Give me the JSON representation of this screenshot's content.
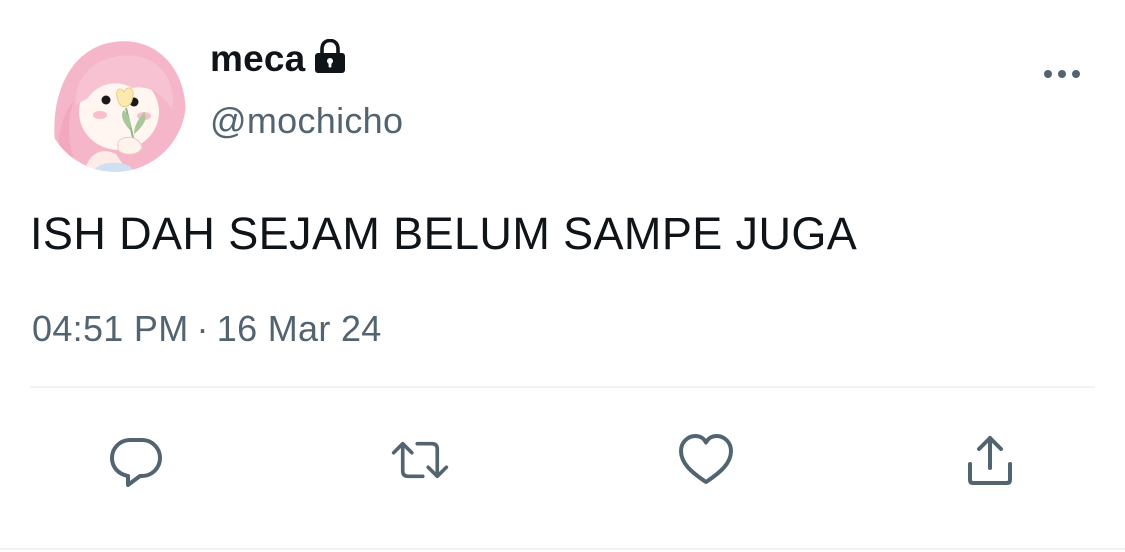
{
  "user": {
    "display_name": "meca",
    "handle": "@mochicho",
    "protected_icon": "lock-icon",
    "avatar": "avatar-illustration"
  },
  "tweet": {
    "text": "ISH DAH SEJAM BELUM SAMPE JUGA",
    "time": "04:51 PM",
    "separator": "·",
    "date": "16 Mar 24"
  },
  "actions": [
    {
      "name": "reply",
      "icon": "reply-icon"
    },
    {
      "name": "retweet",
      "icon": "retweet-icon"
    },
    {
      "name": "like",
      "icon": "heart-icon"
    },
    {
      "name": "share",
      "icon": "share-icon"
    }
  ],
  "colors": {
    "text_primary": "#0f1419",
    "text_secondary": "#536471",
    "divider": "#eff3f4",
    "icon": "#536471"
  }
}
